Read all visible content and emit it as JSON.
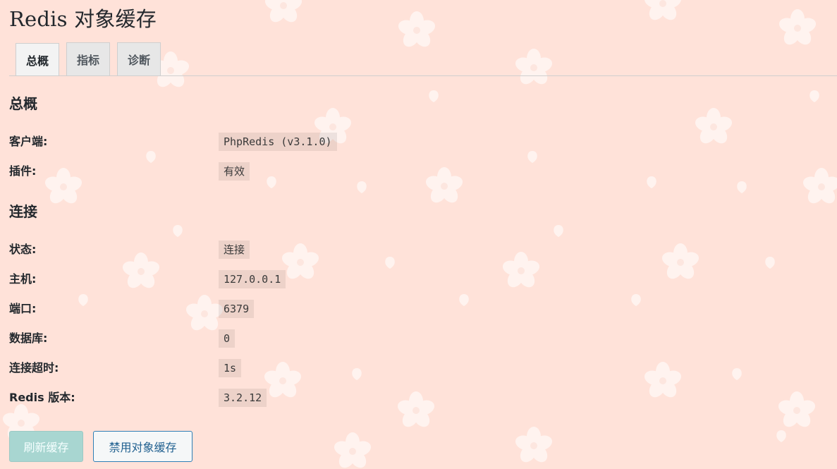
{
  "page": {
    "title": "Redis 对象缓存"
  },
  "tabs": [
    {
      "label": "总概",
      "active": true
    },
    {
      "label": "指标",
      "active": false
    },
    {
      "label": "诊断",
      "active": false
    }
  ],
  "overview": {
    "heading": "总概",
    "rows": [
      {
        "label": "客户端:",
        "value": "PhpRedis (v3.1.0)"
      },
      {
        "label": "插件:",
        "value": "有效"
      }
    ]
  },
  "connection": {
    "heading": "连接",
    "rows": [
      {
        "label": "状态:",
        "value": "连接"
      },
      {
        "label": "主机:",
        "value": "127.0.0.1"
      },
      {
        "label": "端口:",
        "value": "6379"
      },
      {
        "label": "数据库:",
        "value": "0"
      },
      {
        "label": "连接超时:",
        "value": "1s"
      },
      {
        "label": "Redis 版本:",
        "value": "3.2.12"
      }
    ]
  },
  "actions": {
    "flush_label": "刷新缓存",
    "disable_label": "禁用对象缓存"
  },
  "theme": {
    "background": "#ffe2d9",
    "blossom": "#fff1ec",
    "primary_button": "#a8d6d1",
    "secondary_border": "#2e7fb6"
  },
  "background_decoration": {
    "icon": "cherry-blossom-icon"
  }
}
